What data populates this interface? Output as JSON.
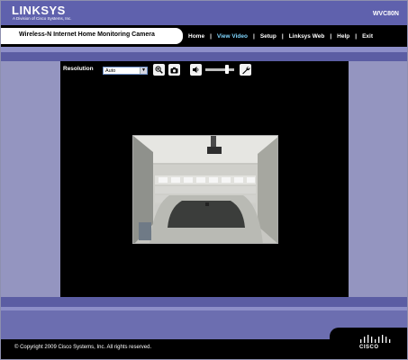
{
  "header": {
    "brand": "LINKSYS",
    "brand_sub": "A Division of Cisco Systems, Inc.",
    "model": "WVC80N"
  },
  "title": "Wireless-N Internet Home Monitoring Camera",
  "nav": {
    "items": [
      {
        "label": "Home"
      },
      {
        "label": "View Video",
        "active": true
      },
      {
        "label": "Setup"
      },
      {
        "label": "Linksys Web"
      },
      {
        "label": "Help"
      },
      {
        "label": "Exit"
      }
    ],
    "separator": "|"
  },
  "toolbar": {
    "resolution_label": "Resolution",
    "resolution_value": "Auto",
    "zoom_icon": "magnifier-plus-icon",
    "snapshot_icon": "camera-icon",
    "volume_icon": "speaker-icon",
    "settings_icon": "wrench-icon"
  },
  "footer": {
    "copyright": "© Copyright 2009 Cisco Systems, Inc. All rights reserved.",
    "cisco": "CISCO"
  },
  "colors": {
    "header_bg": "#5f61ad",
    "active_nav": "#7fd6ff",
    "panel_side": "#9495c0"
  }
}
